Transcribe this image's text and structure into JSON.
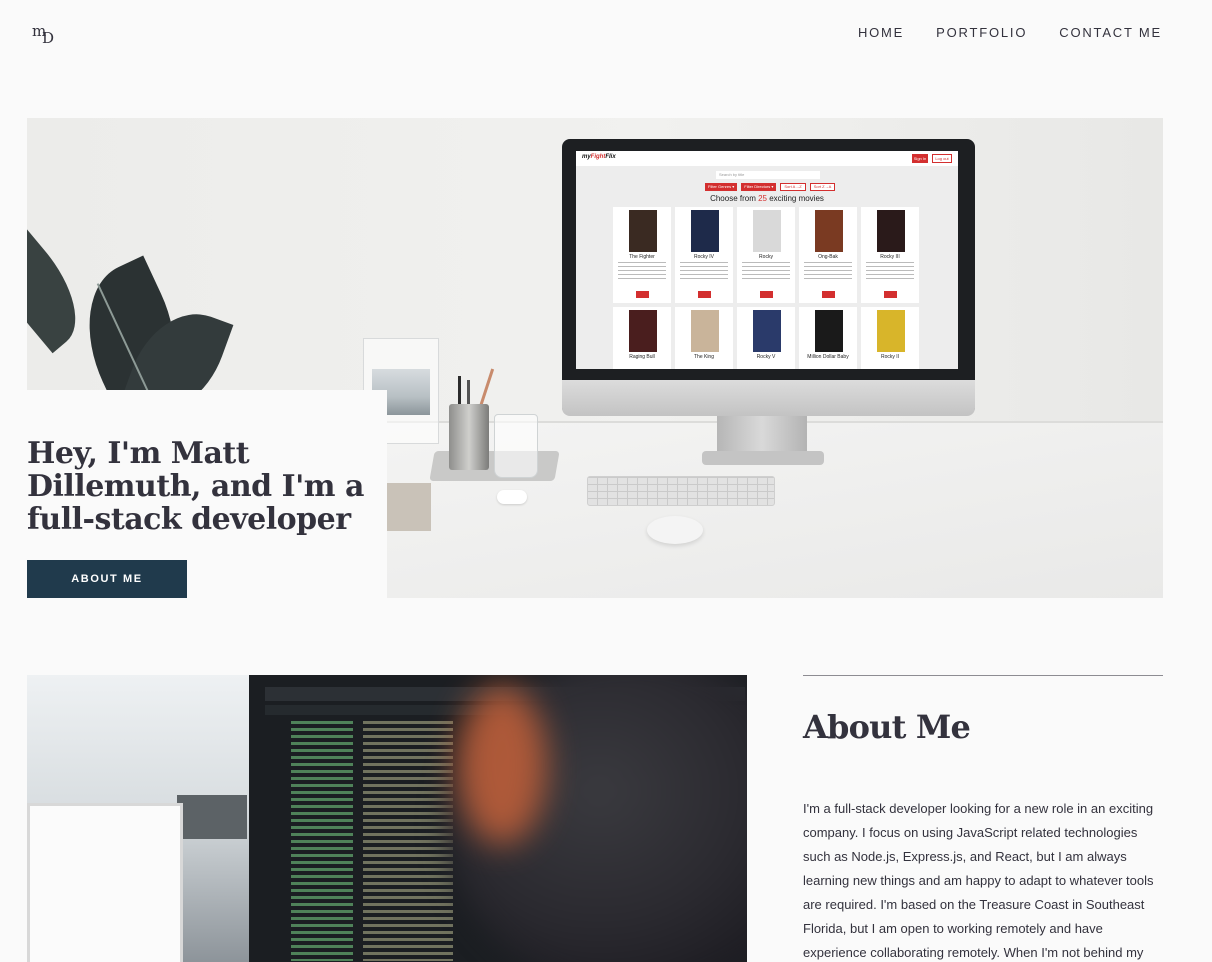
{
  "header": {
    "logo": {
      "m": "m",
      "d": "D"
    },
    "nav": [
      "HOME",
      "PORTFOLIO",
      "CONTACT ME"
    ]
  },
  "hero": {
    "title": "Hey, I'm Matt Dillemuth, and I'm a full-stack developer",
    "button_label": "ABOUT ME",
    "screen": {
      "brand_prefix": "my",
      "brand_accent": "Fight",
      "brand_suffix": "Flix",
      "btn1": "Sign In",
      "btn2": "Log out",
      "search_placeholder": "Search by title",
      "filters": [
        "Filter Genres ▾",
        "Filter Directors ▾",
        "Sort A→Z",
        "Sort Z→A"
      ],
      "choose_prefix": "Choose from ",
      "choose_count": "25",
      "choose_suffix": " exciting movies",
      "movies": [
        "The Fighter",
        "Rocky IV",
        "Rocky",
        "Ong-Bak",
        "Rocky III",
        "Raging Bull",
        "The King",
        "Rocky V",
        "Million Dollar Baby",
        "Rocky II"
      ]
    }
  },
  "about": {
    "title": "About Me",
    "text": "I'm a full-stack developer looking for a new role in an exciting company. I focus on using JavaScript related technologies such as Node.js, Express.js, and React, but I am always learning new things and am happy to adapt to whatever tools are required. I'm based on the Treasure Coast in Southeast Florida, but I am open to working remotely and have experience collaborating remotely. When I'm not behind my computer, I'm"
  },
  "colors": {
    "background": "#fafafa",
    "text": "#33323d",
    "button": "#203a4c",
    "accent_red": "#d32f2f"
  }
}
